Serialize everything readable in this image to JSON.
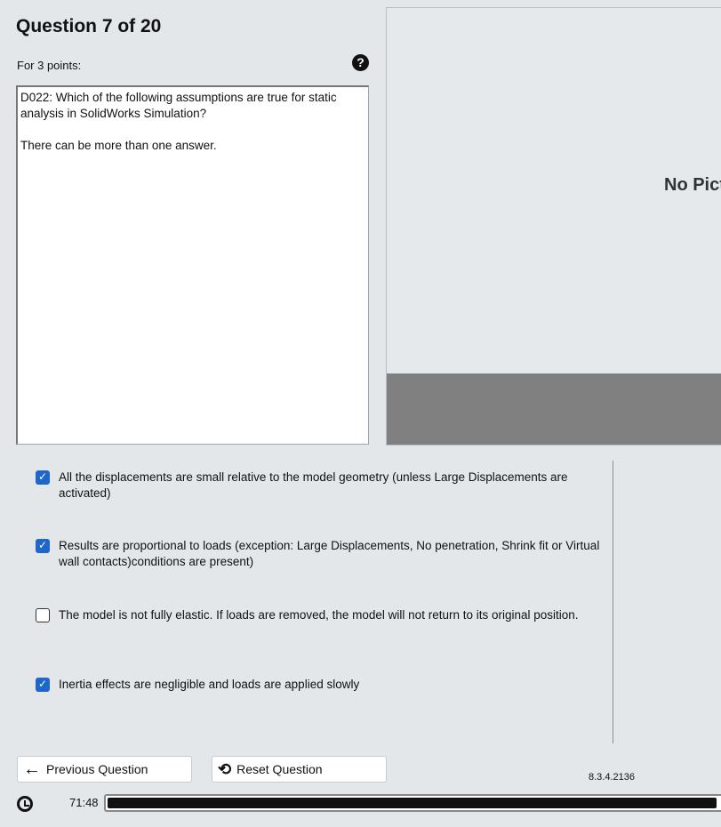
{
  "header": {
    "title": "Question 7 of 20",
    "points": "For 3 points:",
    "help_icon": "question-circle-icon"
  },
  "question": {
    "text": "D022: Which of the following assumptions are true for static analysis in SolidWorks Simulation?\n\nThere can be more than one answer."
  },
  "picture": {
    "placeholder": "No Picture"
  },
  "answers": [
    {
      "text": "All the displacements are small relative to the model geometry (unless Large Displacements are activated)",
      "checked": true
    },
    {
      "text": "Results are proportional to loads (exception: Large Displacements, No penetration, Shrink fit or Virtual wall contacts)conditions are present)",
      "checked": true
    },
    {
      "text": "The model is not fully elastic. If loads are removed, the model will not return to its original position.",
      "checked": false
    },
    {
      "text": "Inertia effects are negligible and loads are applied slowly",
      "checked": true
    }
  ],
  "footer": {
    "previous_label": "Previous Question",
    "reset_label": "Reset Question",
    "version": "8.3.4.2136",
    "time": "71:48",
    "time_progress_percent": 99
  },
  "colors": {
    "checkbox": "#1e66c8",
    "background": "#e3e7ea"
  }
}
